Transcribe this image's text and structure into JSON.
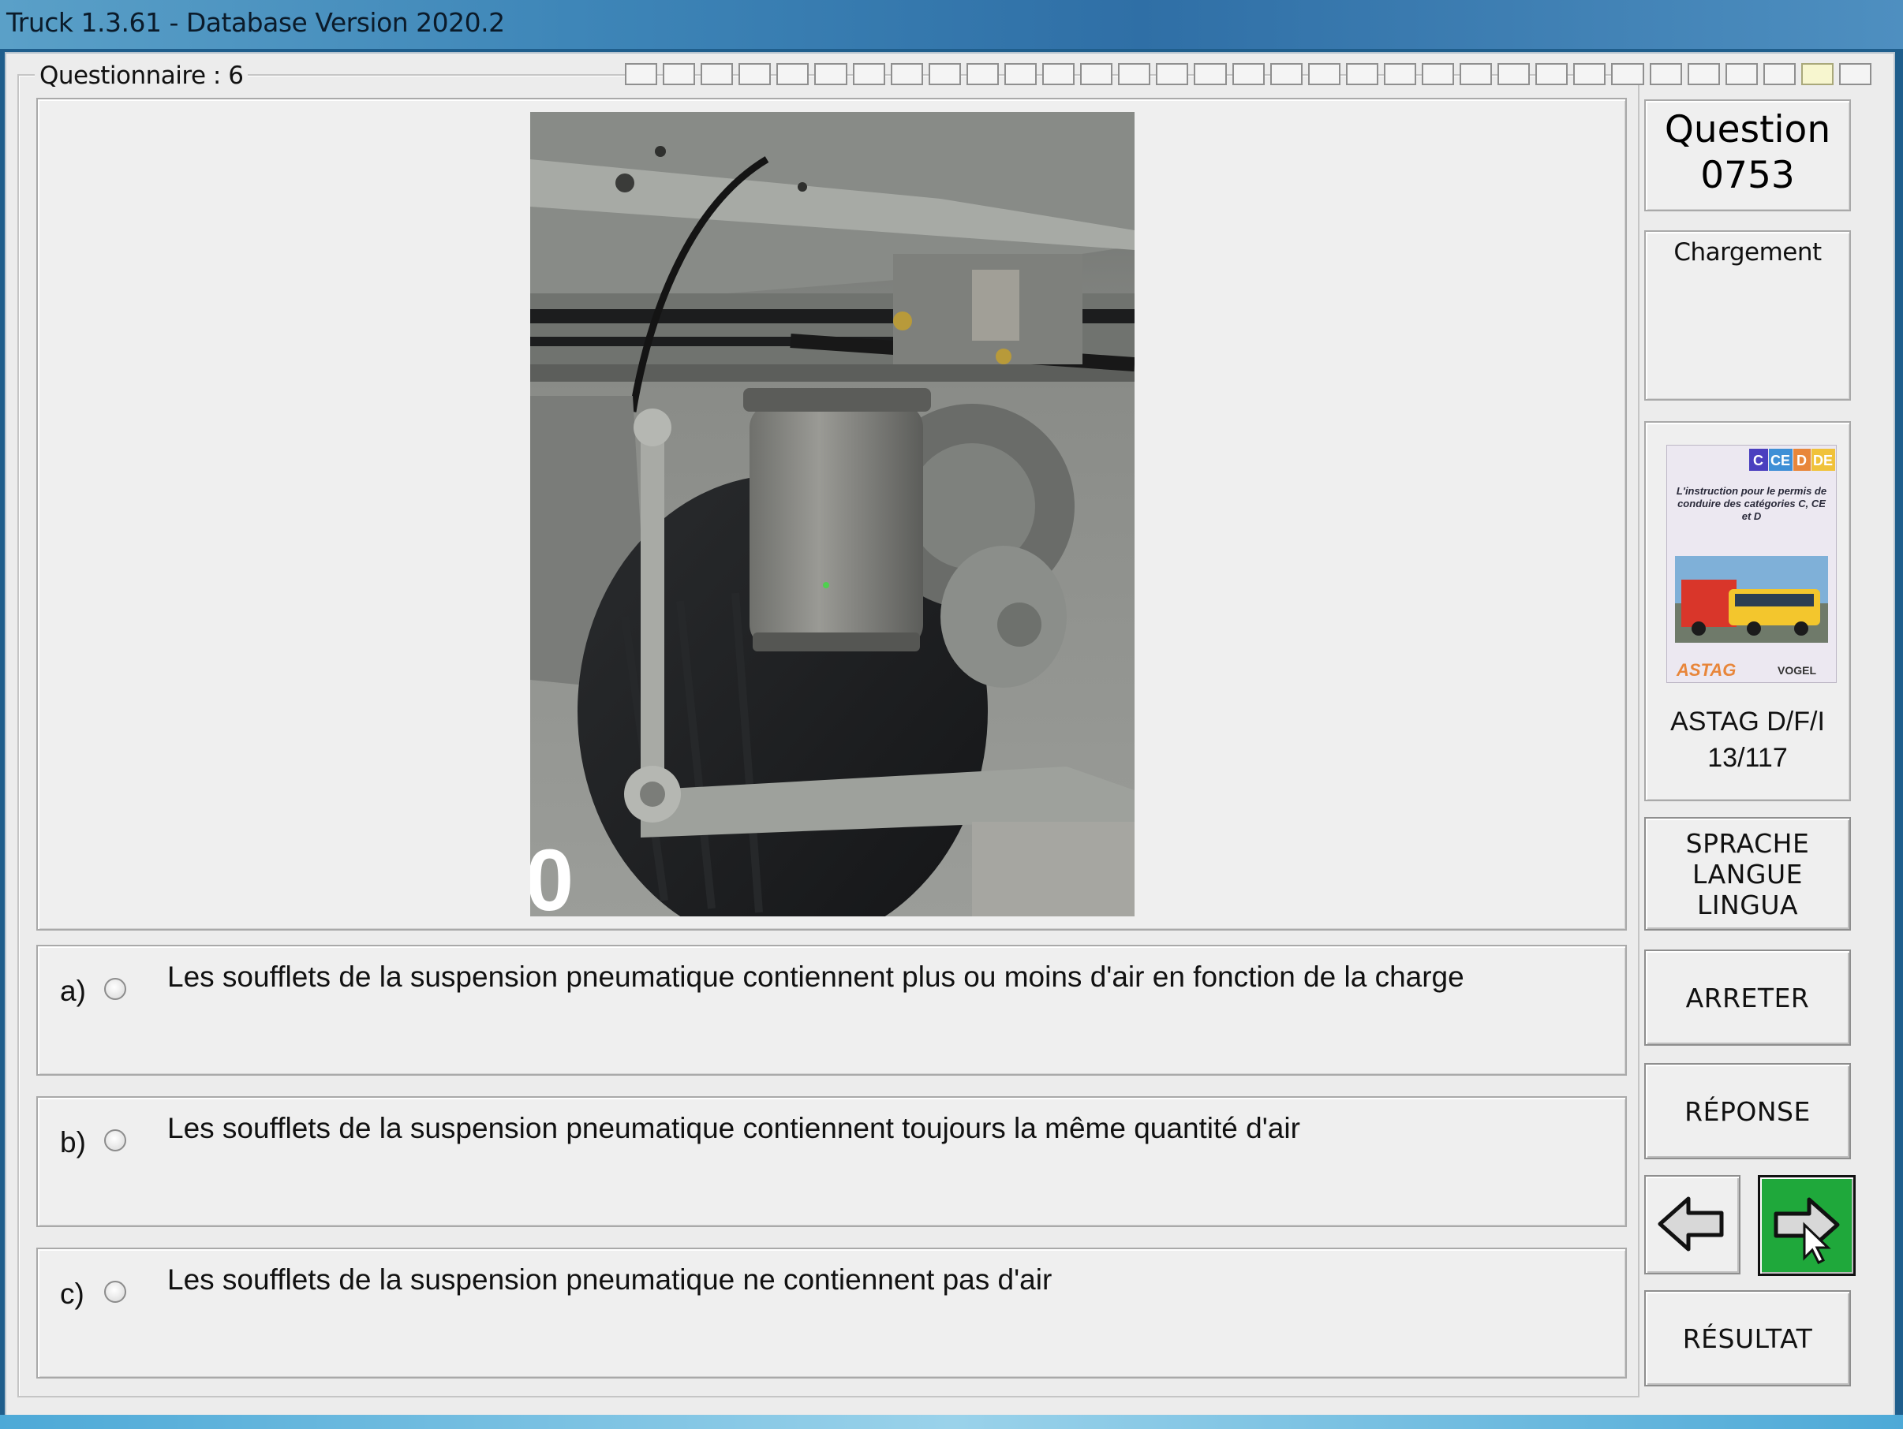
{
  "window": {
    "title": "Truck 1.3.61 - Database Version 2020.2"
  },
  "questionnaire": {
    "label": "Questionnaire : 6",
    "progress_cells": 33,
    "progress_active_index": 31
  },
  "question": {
    "label": "Question",
    "number": "0753",
    "category": "Chargement",
    "image_alt": "truck air suspension bellows photo",
    "image_digit": "0"
  },
  "source": {
    "book_badge": [
      "C",
      "CE",
      "D",
      "DE"
    ],
    "book_title": "L'instruction pour le permis de conduire des catégories C, CE et D",
    "book_publishers": [
      "ASTAG",
      "VOGEL"
    ],
    "label": "ASTAG D/F/I",
    "ref": "13/117"
  },
  "answers": [
    {
      "letter": "a)",
      "text": "Les soufflets de la suspension pneumatique contiennent plus ou moins d'air en fonction de la charge",
      "selected": false
    },
    {
      "letter": "b)",
      "text": "Les soufflets de la suspension pneumatique contiennent toujours la même quantité d'air",
      "selected": false
    },
    {
      "letter": "c)",
      "text": "Les soufflets de la suspension pneumatique ne contiennent pas d'air",
      "selected": false
    }
  ],
  "buttons": {
    "language_lines": [
      "SPRACHE",
      "LANGUE",
      "LINGUA"
    ],
    "stop": "ARRETER",
    "answer": "RÉPONSE",
    "result": "RÉSULTAT",
    "prev_icon": "arrow-left-icon",
    "next_icon": "arrow-right-icon"
  },
  "colors": {
    "next_button": "#1fa83b",
    "progress_active": "#f7f6cf",
    "badge_c": "#4a3fbf",
    "badge_ce": "#3f8fd6",
    "badge_d": "#e8863a",
    "badge_de": "#f0c23a"
  }
}
